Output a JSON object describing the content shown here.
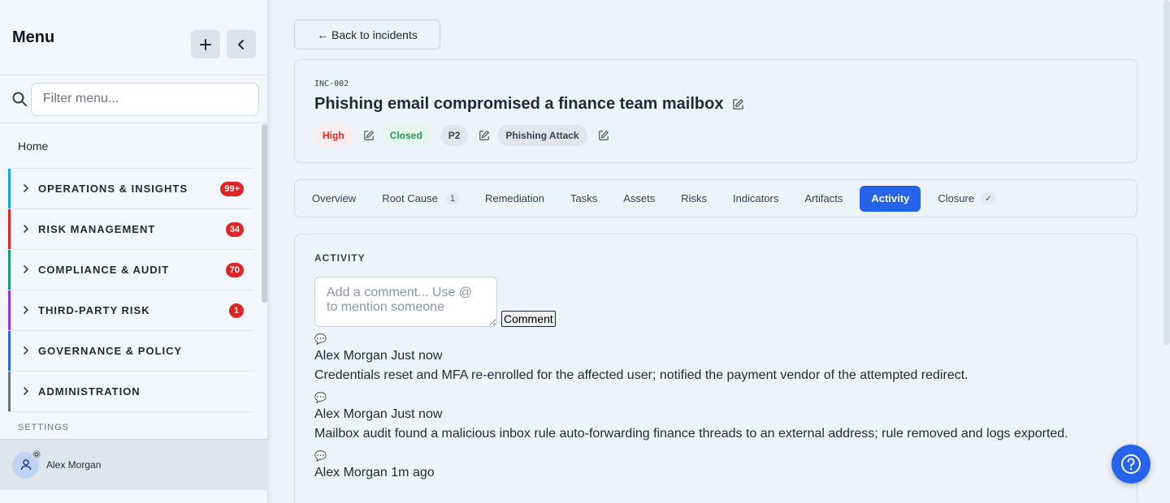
{
  "sidebar": {
    "title": "Menu",
    "filter_placeholder": "Filter menu...",
    "home": "Home",
    "sections": [
      {
        "label": "OPERATIONS & INSIGHTS",
        "badge": "99+",
        "color": "#0ea5e9"
      },
      {
        "label": "RISK MANAGEMENT",
        "badge": "34",
        "color": "#dc2626"
      },
      {
        "label": "COMPLIANCE & AUDIT",
        "badge": "70",
        "color": "#0f9d6e"
      },
      {
        "label": "THIRD-PARTY RISK",
        "badge": "1",
        "color": "#9333ea"
      },
      {
        "label": "GOVERNANCE & POLICY",
        "badge": "",
        "color": "#2563eb"
      },
      {
        "label": "ADMINISTRATION",
        "badge": "",
        "color": "#64748b"
      }
    ],
    "settings_label": "SETTINGS",
    "user_name": "Alex Morgan"
  },
  "main": {
    "back_label": "← Back to incidents",
    "incident": {
      "id": "INC-002",
      "title": "Phishing email compromised a finance team mailbox",
      "severity": "High",
      "status": "Closed",
      "priority": "P2",
      "category": "Phishing Attack"
    },
    "tabs": [
      {
        "label": "Overview",
        "count": ""
      },
      {
        "label": "Root Cause",
        "count": "1"
      },
      {
        "label": "Remediation",
        "count": ""
      },
      {
        "label": "Tasks",
        "count": ""
      },
      {
        "label": "Assets",
        "count": ""
      },
      {
        "label": "Risks",
        "count": ""
      },
      {
        "label": "Indicators",
        "count": ""
      },
      {
        "label": "Artifacts",
        "count": ""
      },
      {
        "label": "Activity",
        "count": ""
      },
      {
        "label": "Closure",
        "count": "✓"
      }
    ],
    "active_tab": "Activity",
    "activity": {
      "title": "ACTIVITY",
      "comment_placeholder": "Add a comment... Use @ to mention someone",
      "comment_button": "Comment",
      "entries": [
        {
          "icon": "💬",
          "meta": "Alex Morgan Just now",
          "text": "Credentials reset and MFA re-enrolled for the affected user; notified the payment vendor of the attempted redirect."
        },
        {
          "icon": "💬",
          "meta": "Alex Morgan Just now",
          "text": "Mailbox audit found a malicious inbox rule auto-forwarding finance threads to an external address; rule removed and logs exported."
        },
        {
          "icon": "💬",
          "meta": "Alex Morgan 1m ago",
          "text": ""
        }
      ]
    }
  },
  "colors": {
    "accent": "#2563eb",
    "badge": "#dc2626"
  }
}
